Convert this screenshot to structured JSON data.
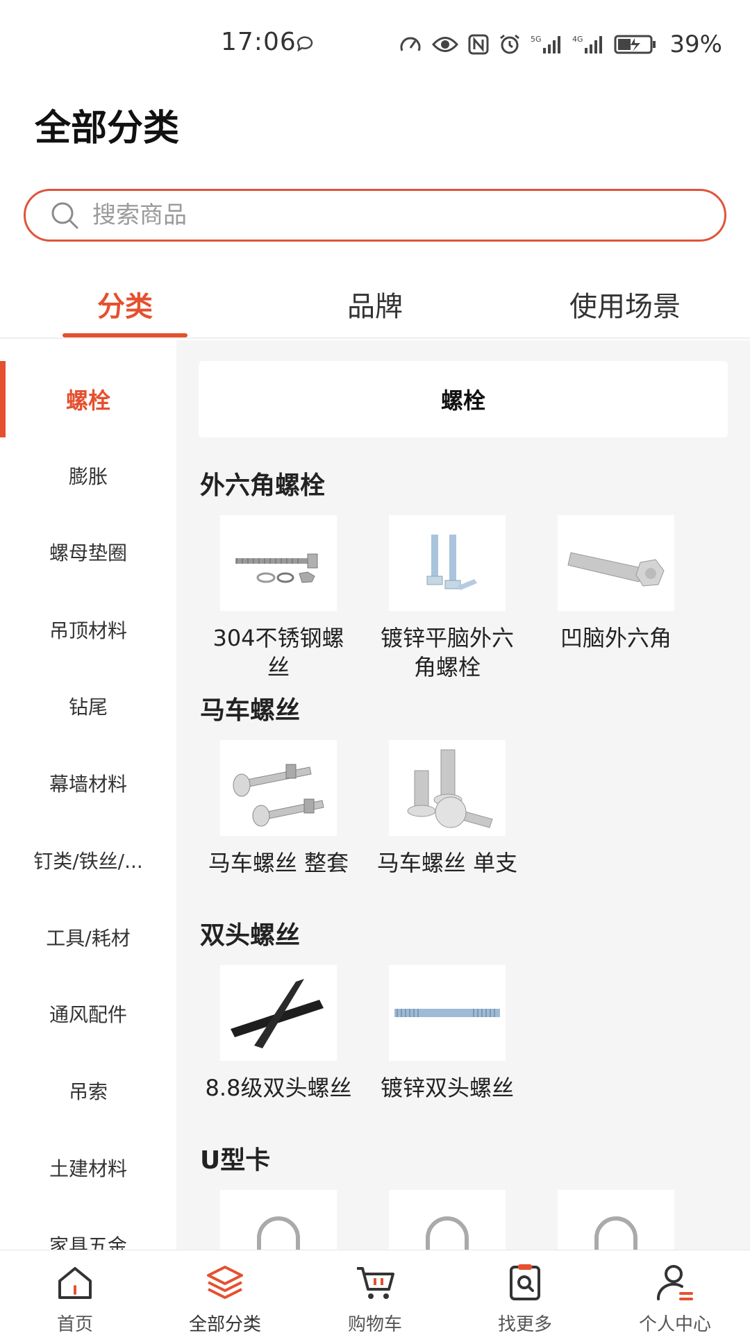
{
  "status_bar": {
    "time": "17:06",
    "battery": "39%",
    "icons": [
      "chat-bubble-icon",
      "speed-icon",
      "eye-icon",
      "nfc-icon",
      "alarm-icon",
      "5g-signal-icon",
      "4g-signal-icon",
      "battery-charging-icon"
    ]
  },
  "header": {
    "title": "全部分类"
  },
  "search": {
    "placeholder": "搜索商品",
    "border_color": "#e0533a"
  },
  "tabs": [
    {
      "label": "分类",
      "active": true
    },
    {
      "label": "品牌",
      "active": false
    },
    {
      "label": "使用场景",
      "active": false
    }
  ],
  "accent_color": "#e5502f",
  "sidebar": {
    "items": [
      {
        "label": "螺栓",
        "active": true
      },
      {
        "label": "膨胀"
      },
      {
        "label": "螺母垫圈"
      },
      {
        "label": "吊顶材料"
      },
      {
        "label": "钻尾"
      },
      {
        "label": "幕墙材料"
      },
      {
        "label": "钉类/铁丝/..."
      },
      {
        "label": "工具/耗材"
      },
      {
        "label": "通风配件"
      },
      {
        "label": "吊索"
      },
      {
        "label": "土建材料"
      },
      {
        "label": "家具五金"
      }
    ]
  },
  "content": {
    "header": "螺栓",
    "sections": [
      {
        "title": "外六角螺栓",
        "products": [
          {
            "name": "304不锈钢螺丝",
            "icon": "hex-bolt-set-icon"
          },
          {
            "name": "镀锌平脑外六角螺栓",
            "icon": "zinc-hex-bolt-icon"
          },
          {
            "name": "凹脑外六角",
            "icon": "concave-hex-bolt-icon"
          }
        ]
      },
      {
        "title": "马车螺丝",
        "products": [
          {
            "name": "马车螺丝 整套",
            "icon": "carriage-bolt-set-icon"
          },
          {
            "name": "马车螺丝 单支",
            "icon": "carriage-bolt-icon"
          }
        ]
      },
      {
        "title": "双头螺丝",
        "products": [
          {
            "name": "8.8级双头螺丝",
            "icon": "black-stud-bolt-icon"
          },
          {
            "name": "镀锌双头螺丝",
            "icon": "zinc-stud-bolt-icon"
          }
        ]
      },
      {
        "title": "U型卡",
        "products": [
          {
            "name": "",
            "icon": "u-bolt-icon"
          },
          {
            "name": "",
            "icon": "u-bolt-icon"
          },
          {
            "name": "",
            "icon": "u-bolt-icon"
          }
        ]
      }
    ]
  },
  "bottom_nav": [
    {
      "label": "首页",
      "icon": "home-icon"
    },
    {
      "label": "全部分类",
      "icon": "layers-icon",
      "active": true
    },
    {
      "label": "购物车",
      "icon": "cart-icon"
    },
    {
      "label": "找更多",
      "icon": "search-more-icon"
    },
    {
      "label": "个人中心",
      "icon": "user-icon"
    }
  ]
}
